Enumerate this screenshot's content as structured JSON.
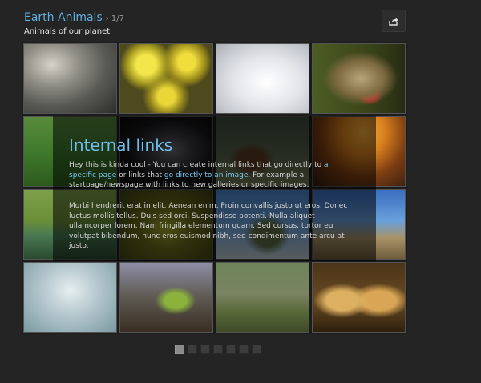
{
  "header": {
    "title": "Earth Animals",
    "separator": "›",
    "counter": "1/7",
    "subtitle": "Animals of our planet"
  },
  "share_button": {
    "icon": "share-icon"
  },
  "thumbnails": [
    "crocodiles",
    "sea-anemones",
    "seal-pup",
    "mandrill",
    "meadow-animals",
    "dark-animal",
    "grizzly-bear",
    "sunset-bison",
    "river-landscape",
    "leaf-insect",
    "cactus-desert",
    "camels",
    "caterpillar",
    "chameleon",
    "cheetah-cubs",
    "cheetahs"
  ],
  "overlay": {
    "title": "Internal links",
    "p1_a": "Hey this is kinda cool - You can create internal links that go directly to ",
    "link1": "a specific page",
    "p1_b": " or links that ",
    "link2": "go directly to an image",
    "p1_c": ". For example a startpage/newspage with links to new galleries or specific images.",
    "p2": "Morbi hendrerit erat in elit. Aenean enim. Proin convallis justo ut eros. Donec luctus mollis tellus. Duis sed orci. Suspendisse potenti. Nulla aliquet ullamcorper lorem. Nam fringilla elementum quam. Sed cursus, tortor eu volutpat bibendum, nunc eros euismod nibh, sed condimentum ante arcu at justo."
  },
  "pager": {
    "pages": 7,
    "active_index": 0
  },
  "colors": {
    "title": "#5fb0e0",
    "link": "#7cc8f0",
    "background": "#242424"
  }
}
